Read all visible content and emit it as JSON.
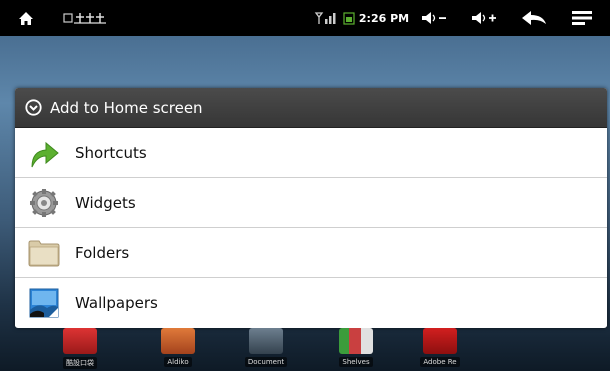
{
  "status_bar": {
    "time": "2:26 PM",
    "icons": [
      "home-icon",
      "usb-icon",
      "signal-icon",
      "battery-icon",
      "volume-down-icon",
      "volume-up-icon",
      "back-icon",
      "menu-icon"
    ]
  },
  "dialog": {
    "title": "Add to Home screen",
    "items": [
      {
        "label": "Shortcuts",
        "icon": "shortcut-arrow-icon"
      },
      {
        "label": "Widgets",
        "icon": "gear-icon"
      },
      {
        "label": "Folders",
        "icon": "folder-icon"
      },
      {
        "label": "Wallpapers",
        "icon": "wallpaper-icon"
      }
    ]
  },
  "dock": {
    "apps": [
      {
        "label": "酷設口袋"
      },
      {
        "label": "Aldiko"
      },
      {
        "label": "Document"
      },
      {
        "label": "Shelves"
      },
      {
        "label": "Adobe Re"
      }
    ]
  },
  "colors": {
    "status_bar": "#000000",
    "dialog_title_bg": "#3d3d3d",
    "dialog_bg": "#ffffff",
    "shortcut_green": "#5cb030",
    "adobe_red": "#c8171c"
  }
}
